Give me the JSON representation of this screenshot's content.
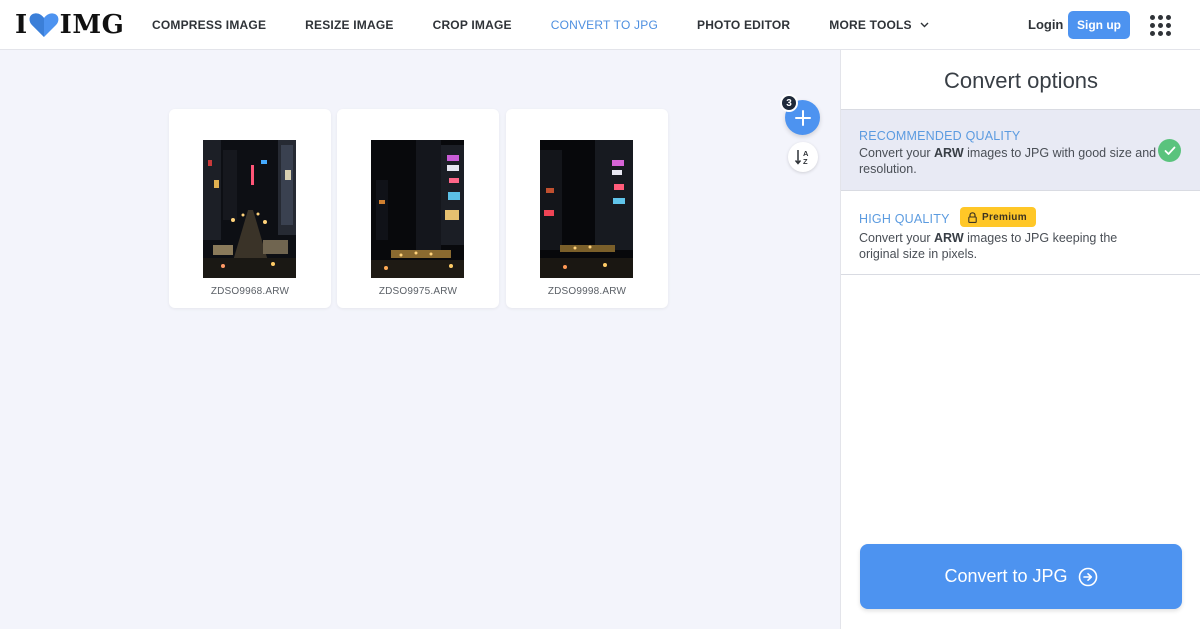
{
  "brand": {
    "logo_left": "I",
    "logo_right": "IMG",
    "accent": "#4d93f0"
  },
  "nav": {
    "items": [
      {
        "label": "COMPRESS IMAGE",
        "active": false
      },
      {
        "label": "RESIZE IMAGE",
        "active": false
      },
      {
        "label": "CROP IMAGE",
        "active": false
      },
      {
        "label": "CONVERT TO JPG",
        "active": true
      },
      {
        "label": "PHOTO EDITOR",
        "active": false
      },
      {
        "label": "MORE TOOLS",
        "active": false
      }
    ]
  },
  "header": {
    "login": "Login",
    "signup": "Sign up"
  },
  "files": {
    "count": "3",
    "items": [
      {
        "name": "ZDSO9968.ARW"
      },
      {
        "name": "ZDSO9975.ARW"
      },
      {
        "name": "ZDSO9998.ARW"
      }
    ]
  },
  "sidebar": {
    "title": "Convert options",
    "recommended": {
      "title": "RECOMMENDED QUALITY",
      "desc_prefix": "Convert your ",
      "desc_format": "ARW",
      "desc_suffix": " images to JPG with good size and resolution."
    },
    "high": {
      "title": "HIGH QUALITY",
      "badge": "Premium",
      "desc_prefix": "Convert your ",
      "desc_format": "ARW",
      "desc_suffix": " images to JPG keeping the original size in pixels."
    },
    "convert_label": "Convert to JPG"
  }
}
